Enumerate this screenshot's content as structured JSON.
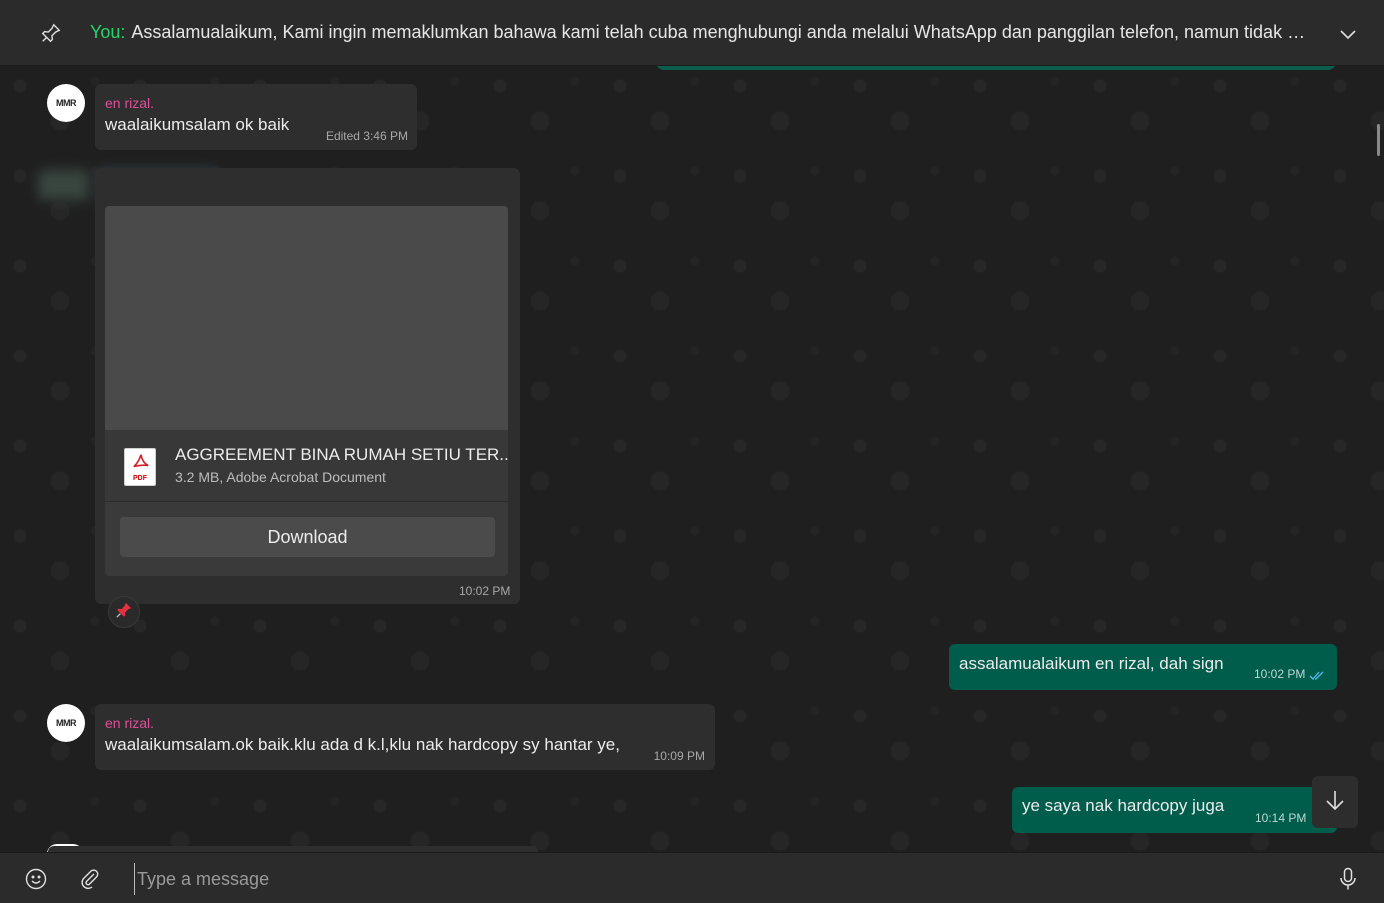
{
  "pinned": {
    "you_label": "You:",
    "text": "Assalamualaikum,  Kami ingin memaklumkan bahawa kami telah cuba menghubungi anda melalui WhatsApp dan panggilan telefon, namun tidak mener…"
  },
  "messages": [
    {
      "sender": "en rizal.",
      "text": "waalaikumsalam ok baik",
      "meta": "Edited 3:46 PM"
    },
    {
      "document": {
        "name": "AGGREEMENT BINA RUMAH SETIU TER...",
        "sub": "3.2 MB, Adobe Acrobat Document",
        "download_label": "Download",
        "pdf_label": "PDF"
      },
      "time": "10:02 PM",
      "reaction": "pushpin"
    },
    {
      "text": "assalamualaikum en rizal, dah sign",
      "time": "10:02 PM",
      "status": "read"
    },
    {
      "sender": "en rizal.",
      "text": "waalaikumsalam.ok baik.klu ada d k.l,klu nak hardcopy sy hantar ye,",
      "time": "10:09 PM"
    },
    {
      "text": "ye saya nak hardcopy juga",
      "time": "10:14 PM"
    }
  ],
  "avatar": {
    "logo": "MMR"
  },
  "compose": {
    "placeholder": "Type a message"
  },
  "colors": {
    "outgoing": "#005c4b",
    "incoming": "#2e2e2e",
    "sender": "#e04e9a",
    "you": "#25d366"
  }
}
